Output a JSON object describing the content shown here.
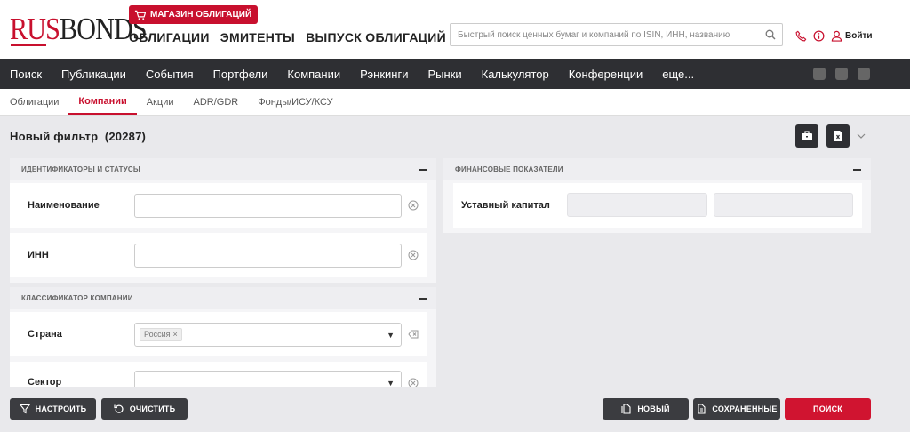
{
  "header": {
    "logo_rus": "RUS",
    "logo_bonds": "BONDS",
    "shop_label": "МАГАЗИН ОБЛИГАЦИЙ",
    "nav": [
      "ОБЛИГАЦИИ",
      "ЭМИТЕНТЫ",
      "ВЫПУСК ОБЛИГАЦИЙ"
    ],
    "search_placeholder": "Быстрый поиск ценных бумаг и компаний по ISIN, ИНН, названию",
    "login_label": "Войти"
  },
  "main_nav": [
    "Поиск",
    "Публикации",
    "События",
    "Портфели",
    "Компании",
    "Рэнкинги",
    "Рынки",
    "Калькулятор",
    "Конференции",
    "еще..."
  ],
  "sub_nav": {
    "items": [
      "Облигации",
      "Компании",
      "Акции",
      "ADR/GDR",
      "Фонды/ИСУ/КСУ"
    ],
    "active": "Компании"
  },
  "filter": {
    "title": "Новый фильтр",
    "count": "(20287)"
  },
  "panels": {
    "identifiers": {
      "title": "ИДЕНТИФИКАТОРЫ И СТАТУСЫ",
      "fields": [
        {
          "label": "Наименование",
          "value": ""
        },
        {
          "label": "ИНН",
          "value": ""
        }
      ]
    },
    "classifier": {
      "title": "КЛАССИФИКАТОР КОМПАНИИ",
      "fields": [
        {
          "label": "Страна",
          "tag": "Россия"
        },
        {
          "label": "Сектор",
          "value": ""
        }
      ]
    },
    "financial": {
      "title": "ФИНАНСОВЫЕ ПОКАЗАТЕЛИ",
      "fields": [
        {
          "label": "Уставный капитал",
          "from": "",
          "to": ""
        }
      ]
    }
  },
  "bottom": {
    "configure": "НАСТРОИТЬ",
    "clear": "ОЧИСТИТЬ",
    "new": "НОВЫЙ",
    "saved": "СОХРАНЕННЫЕ",
    "search": "ПОИСК"
  },
  "colors": {
    "brand_red": "#c8102e",
    "nav_dark": "#2e2f33"
  }
}
